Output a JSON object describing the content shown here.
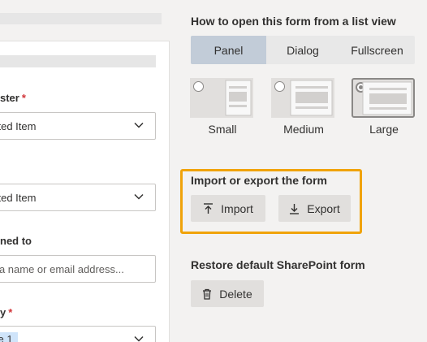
{
  "form": {
    "fields": [
      {
        "label": "ster",
        "required": true,
        "value": "cted Item"
      },
      {
        "label": "",
        "required": false,
        "value": "cted Item"
      },
      {
        "label": "ned to",
        "required": false,
        "placeholder": "r a name or email address..."
      },
      {
        "label": "y",
        "required": true,
        "tag": "ce 1"
      }
    ],
    "required_mark": "*"
  },
  "panel": {
    "open_title": "How to open this form from a list view",
    "open_modes": [
      "Panel",
      "Dialog",
      "Fullscreen"
    ],
    "active_mode": "Panel",
    "sizes": [
      "Small",
      "Medium",
      "Large"
    ],
    "selected_size": "Large",
    "io_title": "Import or export the form",
    "import_label": "Import",
    "export_label": "Export",
    "restore_title": "Restore default SharePoint form",
    "delete_label": "Delete"
  },
  "colors": {
    "panel_bg": "#f3f2f1",
    "active_segment": "#c2ccd8",
    "highlight_border": "#f0a30a",
    "required": "#d13438",
    "tag_bg": "#cfe4fa"
  },
  "icons": [
    "chevron-down-icon",
    "upload-icon",
    "download-icon",
    "trash-icon"
  ]
}
